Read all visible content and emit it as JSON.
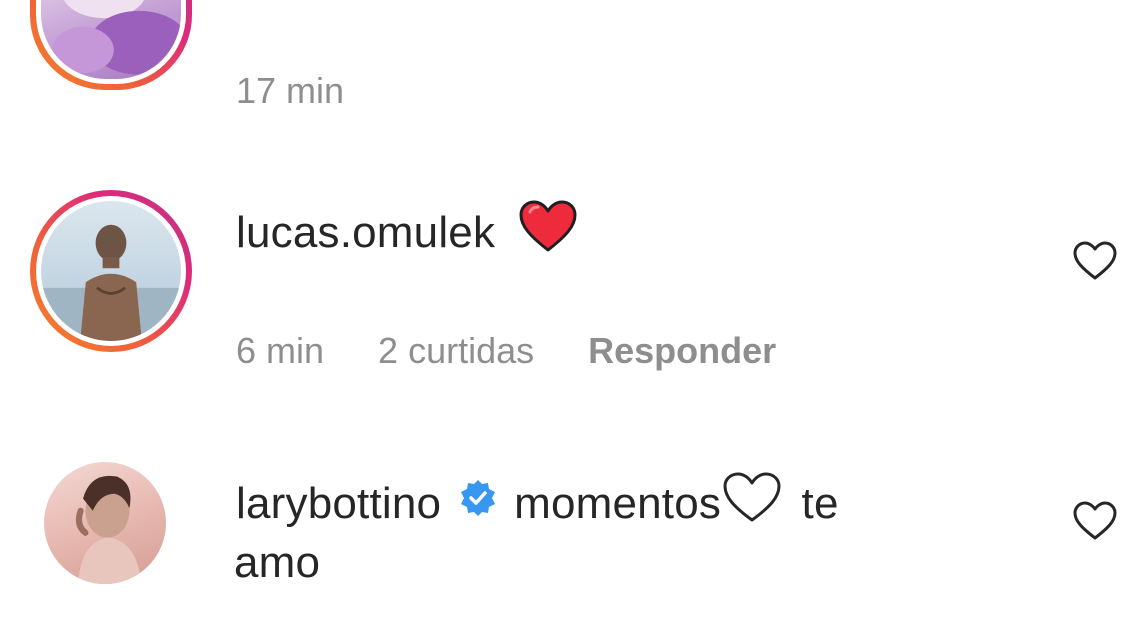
{
  "comments": [
    {
      "time": "17 min"
    },
    {
      "username": "lucas.omulek",
      "emoji": "red-heart",
      "time": "6 min",
      "likes": "2 curtidas",
      "reply": "Responder"
    },
    {
      "username": "larybottino",
      "verified": true,
      "text_part1": "momentos",
      "emoji": "white-heart",
      "text_part2": "te",
      "text_line2": "amo"
    }
  ],
  "colors": {
    "meta_gray": "#8e8e8e",
    "text_dark": "#262626",
    "verified_blue": "#3897f0",
    "heart_red": "#ed2b3d"
  },
  "icons": {
    "like": "heart-outline-icon",
    "verified": "verified-badge-icon"
  }
}
